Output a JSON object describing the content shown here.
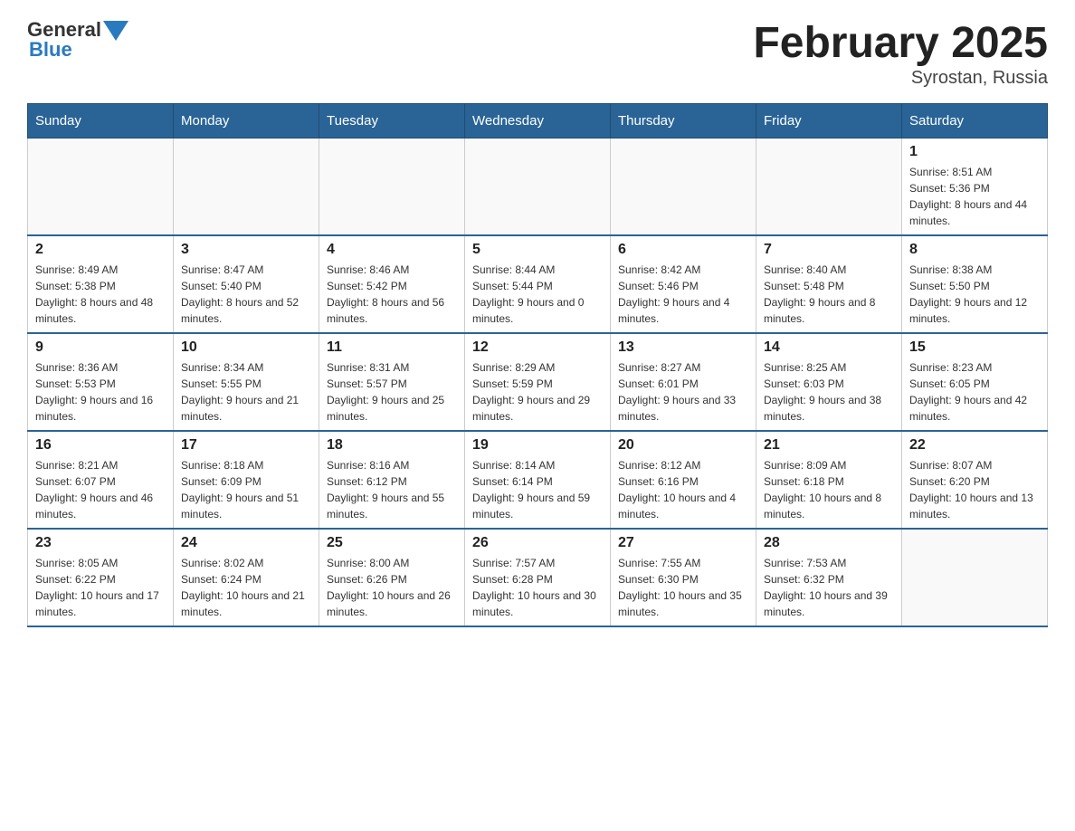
{
  "header": {
    "logo": {
      "general": "General",
      "blue": "Blue"
    },
    "title": "February 2025",
    "location": "Syrostan, Russia"
  },
  "weekdays": [
    "Sunday",
    "Monday",
    "Tuesday",
    "Wednesday",
    "Thursday",
    "Friday",
    "Saturday"
  ],
  "weeks": [
    [
      {
        "day": "",
        "sunrise": "",
        "sunset": "",
        "daylight": ""
      },
      {
        "day": "",
        "sunrise": "",
        "sunset": "",
        "daylight": ""
      },
      {
        "day": "",
        "sunrise": "",
        "sunset": "",
        "daylight": ""
      },
      {
        "day": "",
        "sunrise": "",
        "sunset": "",
        "daylight": ""
      },
      {
        "day": "",
        "sunrise": "",
        "sunset": "",
        "daylight": ""
      },
      {
        "day": "",
        "sunrise": "",
        "sunset": "",
        "daylight": ""
      },
      {
        "day": "1",
        "sunrise": "Sunrise: 8:51 AM",
        "sunset": "Sunset: 5:36 PM",
        "daylight": "Daylight: 8 hours and 44 minutes."
      }
    ],
    [
      {
        "day": "2",
        "sunrise": "Sunrise: 8:49 AM",
        "sunset": "Sunset: 5:38 PM",
        "daylight": "Daylight: 8 hours and 48 minutes."
      },
      {
        "day": "3",
        "sunrise": "Sunrise: 8:47 AM",
        "sunset": "Sunset: 5:40 PM",
        "daylight": "Daylight: 8 hours and 52 minutes."
      },
      {
        "day": "4",
        "sunrise": "Sunrise: 8:46 AM",
        "sunset": "Sunset: 5:42 PM",
        "daylight": "Daylight: 8 hours and 56 minutes."
      },
      {
        "day": "5",
        "sunrise": "Sunrise: 8:44 AM",
        "sunset": "Sunset: 5:44 PM",
        "daylight": "Daylight: 9 hours and 0 minutes."
      },
      {
        "day": "6",
        "sunrise": "Sunrise: 8:42 AM",
        "sunset": "Sunset: 5:46 PM",
        "daylight": "Daylight: 9 hours and 4 minutes."
      },
      {
        "day": "7",
        "sunrise": "Sunrise: 8:40 AM",
        "sunset": "Sunset: 5:48 PM",
        "daylight": "Daylight: 9 hours and 8 minutes."
      },
      {
        "day": "8",
        "sunrise": "Sunrise: 8:38 AM",
        "sunset": "Sunset: 5:50 PM",
        "daylight": "Daylight: 9 hours and 12 minutes."
      }
    ],
    [
      {
        "day": "9",
        "sunrise": "Sunrise: 8:36 AM",
        "sunset": "Sunset: 5:53 PM",
        "daylight": "Daylight: 9 hours and 16 minutes."
      },
      {
        "day": "10",
        "sunrise": "Sunrise: 8:34 AM",
        "sunset": "Sunset: 5:55 PM",
        "daylight": "Daylight: 9 hours and 21 minutes."
      },
      {
        "day": "11",
        "sunrise": "Sunrise: 8:31 AM",
        "sunset": "Sunset: 5:57 PM",
        "daylight": "Daylight: 9 hours and 25 minutes."
      },
      {
        "day": "12",
        "sunrise": "Sunrise: 8:29 AM",
        "sunset": "Sunset: 5:59 PM",
        "daylight": "Daylight: 9 hours and 29 minutes."
      },
      {
        "day": "13",
        "sunrise": "Sunrise: 8:27 AM",
        "sunset": "Sunset: 6:01 PM",
        "daylight": "Daylight: 9 hours and 33 minutes."
      },
      {
        "day": "14",
        "sunrise": "Sunrise: 8:25 AM",
        "sunset": "Sunset: 6:03 PM",
        "daylight": "Daylight: 9 hours and 38 minutes."
      },
      {
        "day": "15",
        "sunrise": "Sunrise: 8:23 AM",
        "sunset": "Sunset: 6:05 PM",
        "daylight": "Daylight: 9 hours and 42 minutes."
      }
    ],
    [
      {
        "day": "16",
        "sunrise": "Sunrise: 8:21 AM",
        "sunset": "Sunset: 6:07 PM",
        "daylight": "Daylight: 9 hours and 46 minutes."
      },
      {
        "day": "17",
        "sunrise": "Sunrise: 8:18 AM",
        "sunset": "Sunset: 6:09 PM",
        "daylight": "Daylight: 9 hours and 51 minutes."
      },
      {
        "day": "18",
        "sunrise": "Sunrise: 8:16 AM",
        "sunset": "Sunset: 6:12 PM",
        "daylight": "Daylight: 9 hours and 55 minutes."
      },
      {
        "day": "19",
        "sunrise": "Sunrise: 8:14 AM",
        "sunset": "Sunset: 6:14 PM",
        "daylight": "Daylight: 9 hours and 59 minutes."
      },
      {
        "day": "20",
        "sunrise": "Sunrise: 8:12 AM",
        "sunset": "Sunset: 6:16 PM",
        "daylight": "Daylight: 10 hours and 4 minutes."
      },
      {
        "day": "21",
        "sunrise": "Sunrise: 8:09 AM",
        "sunset": "Sunset: 6:18 PM",
        "daylight": "Daylight: 10 hours and 8 minutes."
      },
      {
        "day": "22",
        "sunrise": "Sunrise: 8:07 AM",
        "sunset": "Sunset: 6:20 PM",
        "daylight": "Daylight: 10 hours and 13 minutes."
      }
    ],
    [
      {
        "day": "23",
        "sunrise": "Sunrise: 8:05 AM",
        "sunset": "Sunset: 6:22 PM",
        "daylight": "Daylight: 10 hours and 17 minutes."
      },
      {
        "day": "24",
        "sunrise": "Sunrise: 8:02 AM",
        "sunset": "Sunset: 6:24 PM",
        "daylight": "Daylight: 10 hours and 21 minutes."
      },
      {
        "day": "25",
        "sunrise": "Sunrise: 8:00 AM",
        "sunset": "Sunset: 6:26 PM",
        "daylight": "Daylight: 10 hours and 26 minutes."
      },
      {
        "day": "26",
        "sunrise": "Sunrise: 7:57 AM",
        "sunset": "Sunset: 6:28 PM",
        "daylight": "Daylight: 10 hours and 30 minutes."
      },
      {
        "day": "27",
        "sunrise": "Sunrise: 7:55 AM",
        "sunset": "Sunset: 6:30 PM",
        "daylight": "Daylight: 10 hours and 35 minutes."
      },
      {
        "day": "28",
        "sunrise": "Sunrise: 7:53 AM",
        "sunset": "Sunset: 6:32 PM",
        "daylight": "Daylight: 10 hours and 39 minutes."
      },
      {
        "day": "",
        "sunrise": "",
        "sunset": "",
        "daylight": ""
      }
    ]
  ]
}
